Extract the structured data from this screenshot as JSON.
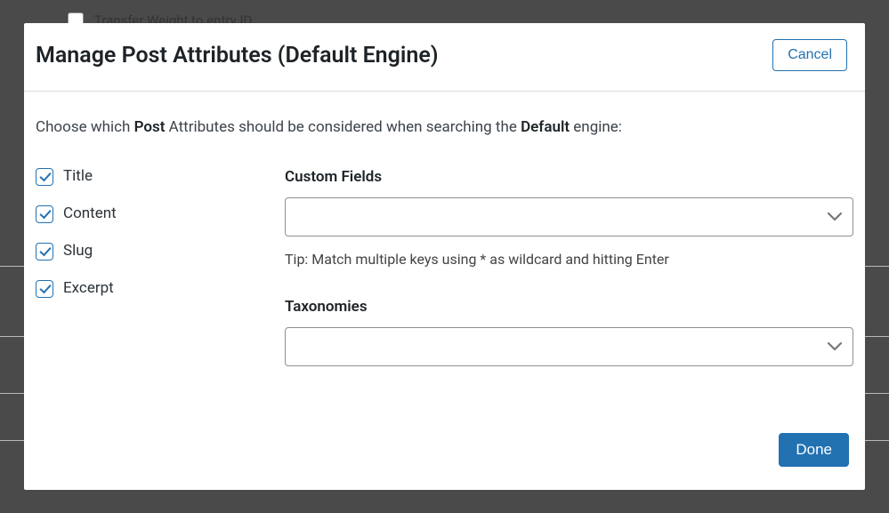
{
  "background": {
    "checkbox_label": "Transfer Weight to entry ID"
  },
  "modal": {
    "title": "Manage Post Attributes (Default Engine)",
    "cancel_label": "Cancel",
    "description_prefix": "Choose which ",
    "description_bold1": "Post",
    "description_mid": " Attributes should be considered when searching the ",
    "description_bold2": "Default",
    "description_suffix": " engine:",
    "checkboxes": [
      {
        "label": "Title",
        "checked": true
      },
      {
        "label": "Content",
        "checked": true
      },
      {
        "label": "Slug",
        "checked": true
      },
      {
        "label": "Excerpt",
        "checked": true
      }
    ],
    "custom_fields": {
      "label": "Custom Fields",
      "tip": "Tip: Match multiple keys using * as wildcard and hitting Enter"
    },
    "taxonomies": {
      "label": "Taxonomies"
    },
    "done_label": "Done"
  }
}
